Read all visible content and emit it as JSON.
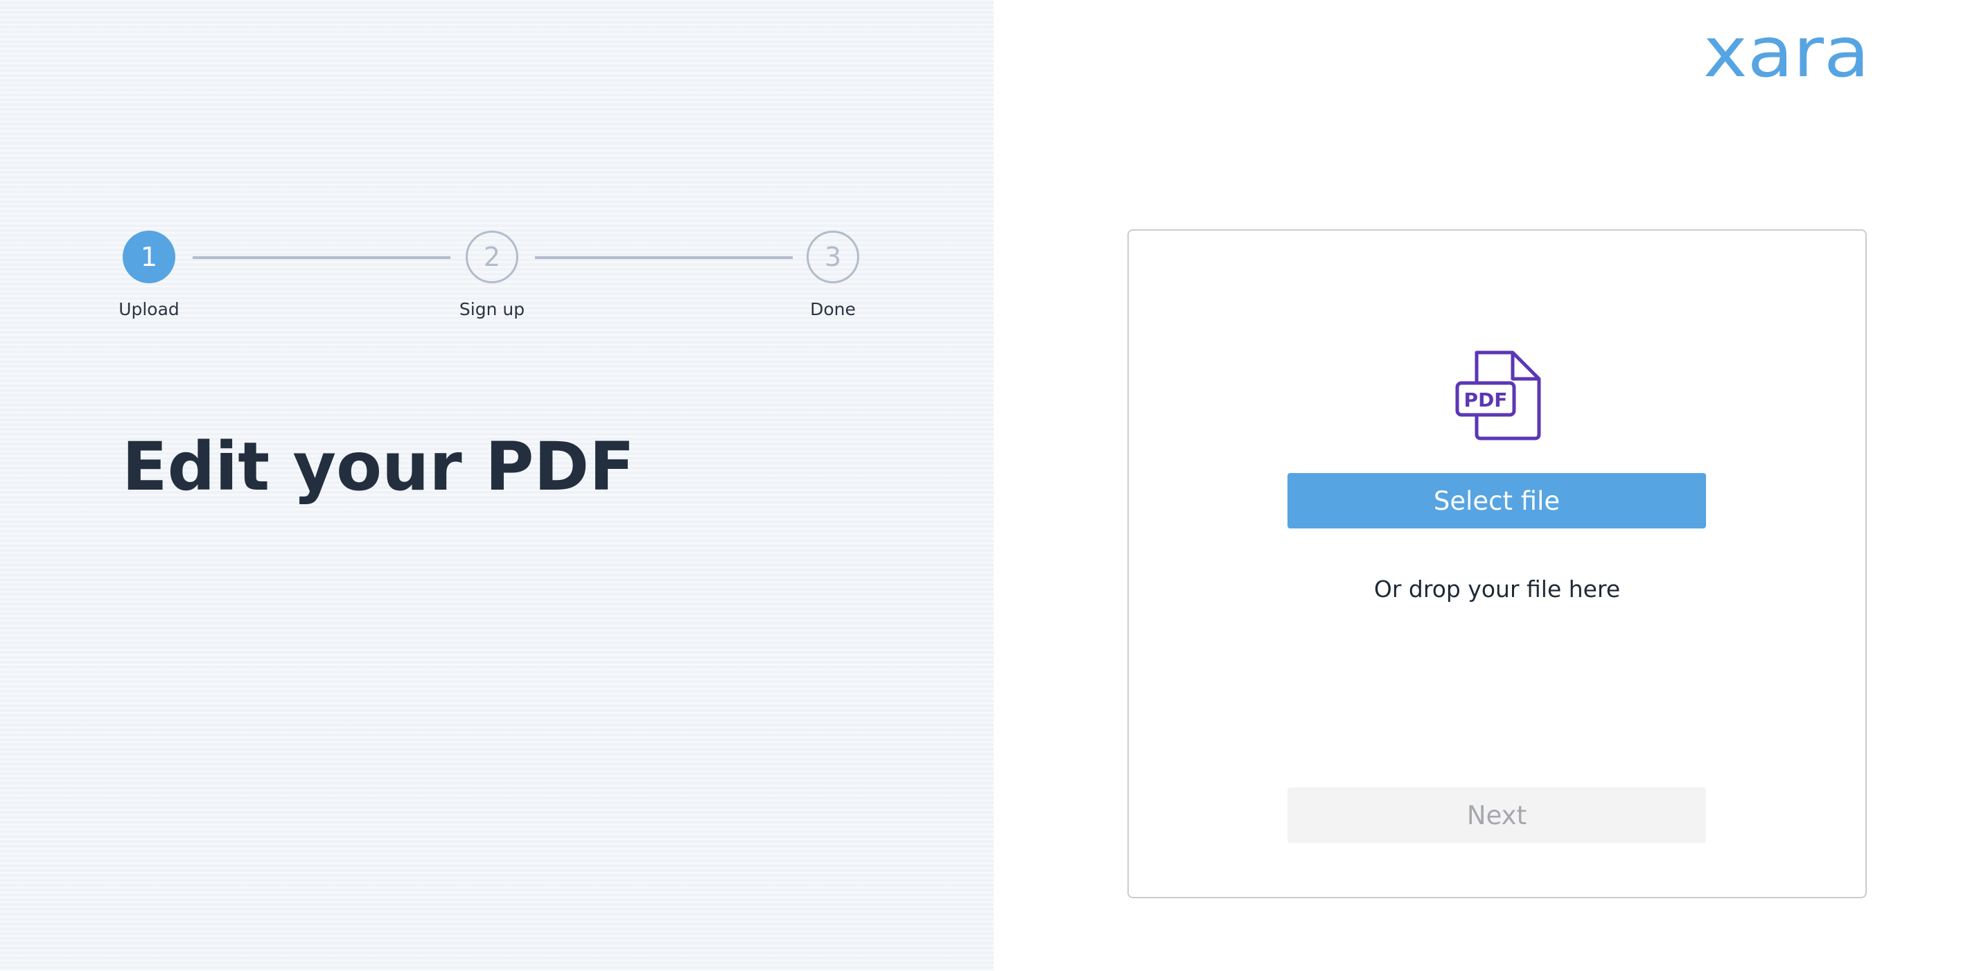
{
  "brand": {
    "logo_text": "xara",
    "color": "#56a4e2"
  },
  "stepper": {
    "active_color": "#56a4e2",
    "inactive_color": "#b2bccb",
    "steps": [
      {
        "number": "1",
        "label": "Upload",
        "state": "active"
      },
      {
        "number": "2",
        "label": "Sign up",
        "state": "inactive"
      },
      {
        "number": "3",
        "label": "Done",
        "state": "inactive"
      }
    ]
  },
  "main": {
    "heading": "Edit your PDF"
  },
  "upload": {
    "icon": "pdf-file-icon",
    "icon_text": "PDF",
    "icon_color": "#5b37b5",
    "select_label": "Select file",
    "drop_text": "Or drop your file here",
    "next_label": "Next",
    "next_disabled": true
  }
}
